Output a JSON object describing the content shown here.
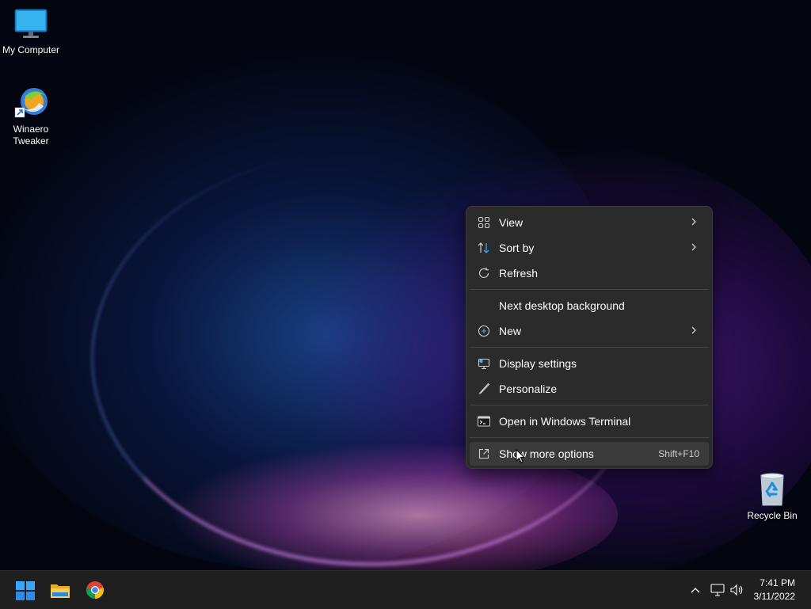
{
  "desktop": {
    "icons": [
      {
        "label": "My Computer",
        "icon": "monitor-icon"
      },
      {
        "label_line1": "Winaero",
        "label_line2": "Tweaker",
        "icon": "winaero-tweaker-icon"
      },
      {
        "label": "Recycle Bin",
        "icon": "recycle-bin-icon"
      }
    ]
  },
  "context_menu": {
    "items": [
      {
        "label": "View",
        "icon": "grid-icon",
        "submenu": true
      },
      {
        "label": "Sort by",
        "icon": "sort-icon",
        "submenu": true
      },
      {
        "label": "Refresh",
        "icon": "refresh-icon"
      },
      {
        "label": "Next desktop background",
        "icon": ""
      },
      {
        "label": "New",
        "icon": "plus-circle-icon",
        "submenu": true
      },
      {
        "label": "Display settings",
        "icon": "display-icon"
      },
      {
        "label": "Personalize",
        "icon": "pen-icon"
      },
      {
        "label": "Open in Windows Terminal",
        "icon": "terminal-icon"
      },
      {
        "label": "Show more options",
        "icon": "expand-icon",
        "shortcut": "Shift+F10",
        "hovered": true
      }
    ]
  },
  "taskbar": {
    "apps": [
      "start-icon",
      "file-explorer-icon",
      "chrome-icon"
    ],
    "tray": [
      "chevron-up-icon",
      "network-icon",
      "volume-icon"
    ],
    "clock": {
      "time": "7:41 PM",
      "date": "3/11/2022"
    }
  },
  "colors": {
    "menu_bg": "#2b2b2b",
    "taskbar_bg": "#1f1f1f",
    "accent": "#0078d4"
  }
}
